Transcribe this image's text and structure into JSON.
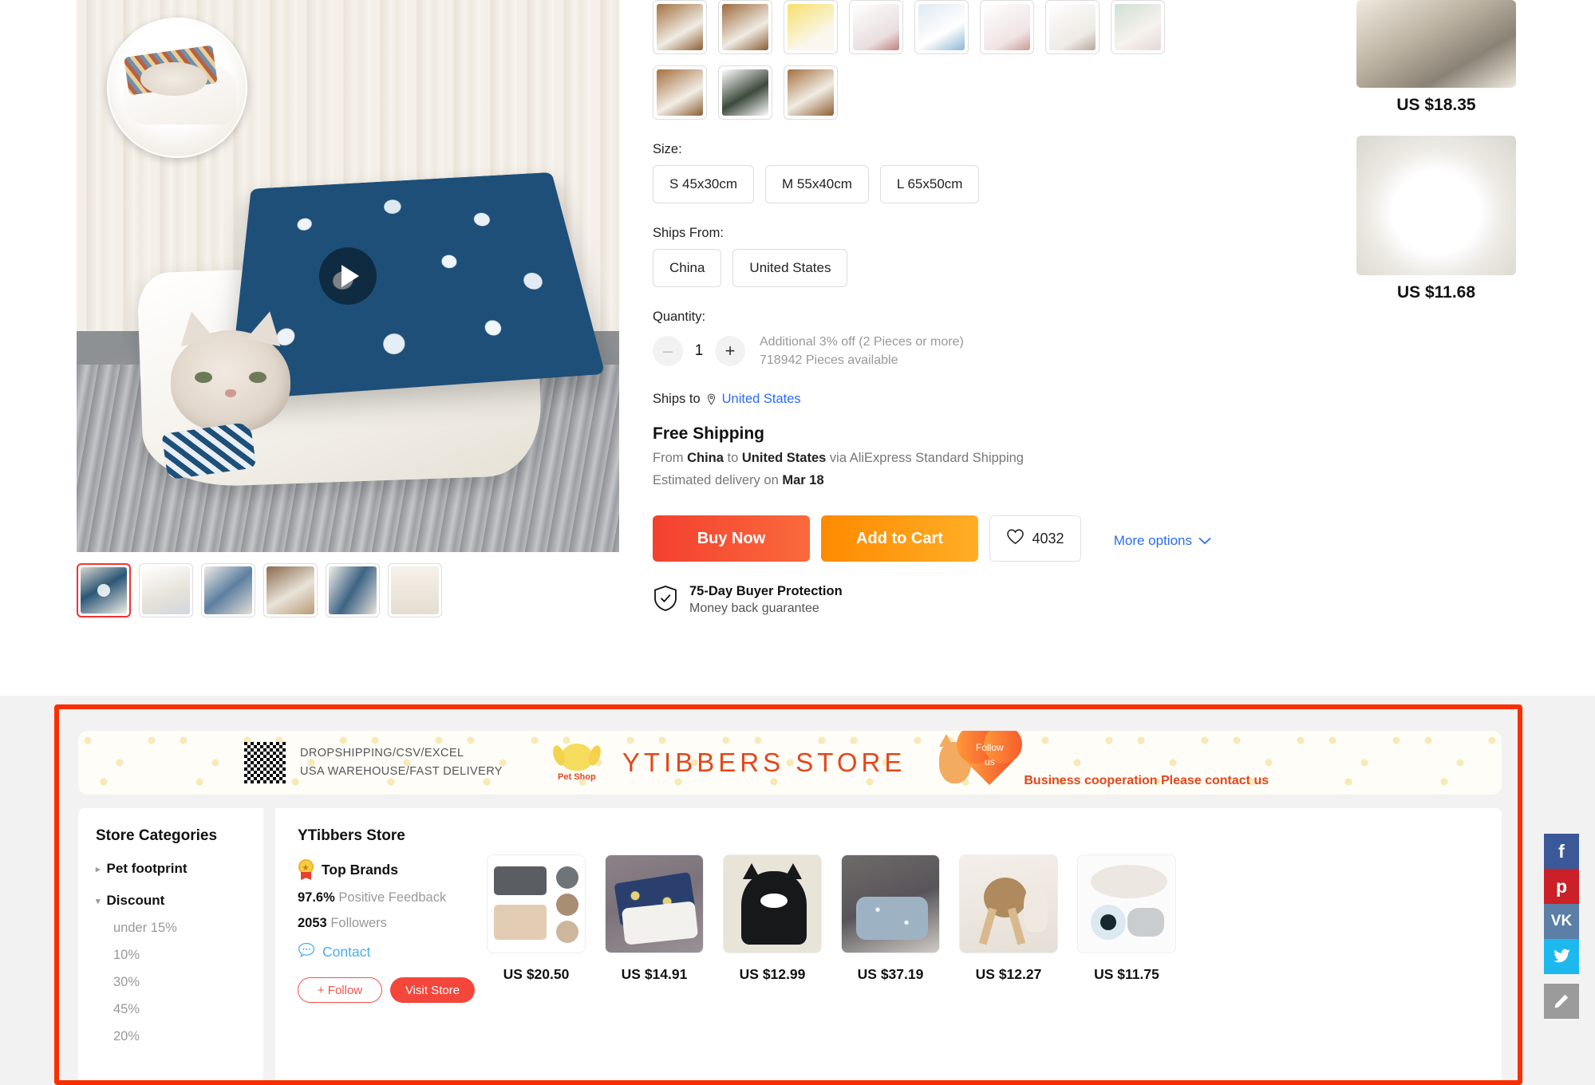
{
  "product": {
    "size_label": "Size:",
    "sizes": [
      "S 45x30cm",
      "M 55x40cm",
      "L 65x50cm"
    ],
    "ships_from_label": "Ships From:",
    "ships_from": [
      "China",
      "United States"
    ],
    "quantity_label": "Quantity:",
    "quantity_value": "1",
    "minus_label": "–",
    "plus_label": "+",
    "qty_note_1": "Additional 3% off (2 Pieces or more)",
    "qty_note_2": "718942 Pieces available",
    "ships_to_label": "Ships to",
    "ships_to_value": "United States",
    "free_shipping": "Free Shipping",
    "ship_from_word": "From",
    "ship_from_country": "China",
    "ship_to_word": "to",
    "ship_to_country": "United States",
    "ship_via": "via AliExpress Standard Shipping",
    "estimated_prefix": "Estimated delivery on",
    "estimated_date": "Mar 18",
    "more_options": "More options",
    "buy_now": "Buy Now",
    "add_to_cart": "Add to Cart",
    "wishlist_count": "4032",
    "protection_title": "75-Day Buyer Protection",
    "protection_sub": "Money back guarantee"
  },
  "recommendations": [
    {
      "price": "US $18.35"
    },
    {
      "price": "US $11.68"
    }
  ],
  "store_banner": {
    "line1": "DROPSHIPPING/CSV/EXCEL",
    "line2": "USA WAREHOUSE/FAST DELIVERY",
    "pet_shop_label": "Pet Shop",
    "store_title": "YTIBBERS STORE",
    "follow_line1": "Follow",
    "follow_line2": "us",
    "cooperation": "Business cooperation Please contact us"
  },
  "store_categories": {
    "title": "Store Categories",
    "items": [
      {
        "label": "Pet footprint",
        "expanded": false
      },
      {
        "label": "Discount",
        "expanded": true
      }
    ],
    "discount_options": [
      "under 15%",
      "10%",
      "30%",
      "45%",
      "20%"
    ]
  },
  "store_info": {
    "name": "YTibbers Store",
    "badge": "Top Brands",
    "feedback_value": "97.6%",
    "feedback_label": "Positive Feedback",
    "followers_value": "2053",
    "followers_label": "Followers",
    "contact": "Contact",
    "follow_button": "+ Follow",
    "visit_button": "Visit Store"
  },
  "store_products": [
    {
      "price": "US $20.50"
    },
    {
      "price": "US $14.91"
    },
    {
      "price": "US $12.99"
    },
    {
      "price": "US $37.19"
    },
    {
      "price": "US $12.27"
    },
    {
      "price": "US $11.75"
    }
  ],
  "social": [
    {
      "name": "facebook",
      "glyph": "f"
    },
    {
      "name": "pinterest",
      "glyph": "р"
    },
    {
      "name": "vk",
      "glyph": "VK"
    },
    {
      "name": "twitter",
      "glyph": "ᵛ"
    },
    {
      "name": "edit",
      "glyph": "✎"
    }
  ],
  "colors": {
    "buy_now": "#f4402f",
    "add_to_cart": "#fd8a00",
    "link": "#2b6cf5",
    "highlight": "#fb2e00",
    "store_brand": "#e2471b",
    "visit_store": "#f5463c"
  }
}
